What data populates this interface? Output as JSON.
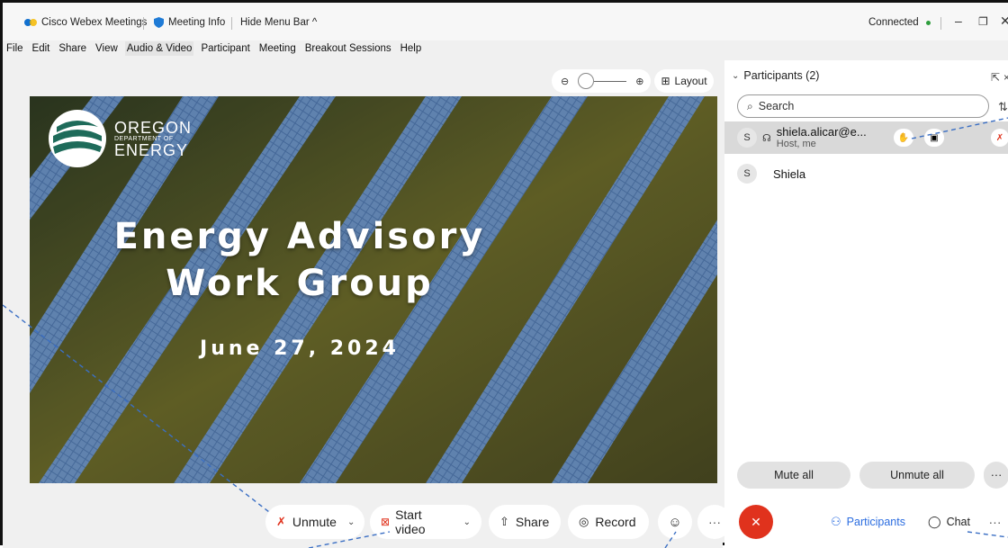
{
  "titlebar": {
    "app_name": "Cisco Webex Meetings",
    "meeting_info": "Meeting Info",
    "hide_menu": "Hide Menu Bar ^",
    "status": "Connected",
    "status_color": "#2e9d3c"
  },
  "menu": [
    "File",
    "Edit",
    "Share",
    "View",
    "Audio & Video",
    "Participant",
    "Meeting",
    "Breakout Sessions",
    "Help"
  ],
  "stage": {
    "layout_label": "Layout",
    "slide": {
      "logo_line1": "OREGON",
      "logo_line2": "DEPARTMENT OF",
      "logo_line3": "ENERGY",
      "title_line1": "Energy Advisory",
      "title_line2": "Work Group",
      "date": "June 27, 2024"
    }
  },
  "controls": {
    "unmute": "Unmute",
    "start_video": "Start video",
    "share": "Share",
    "record": "Record",
    "more": "···",
    "participants": "Participants",
    "chat": "Chat",
    "end_color": "#e0321d",
    "accent": "#2b6de0"
  },
  "panel": {
    "title": "Participants (2)",
    "search_placeholder": "Search",
    "participants": [
      {
        "initial": "S",
        "name": "shiela.alicar@e...",
        "role": "Host, me"
      },
      {
        "initial": "S",
        "name": "Shiela",
        "role": ""
      }
    ],
    "mute_all": "Mute all",
    "unmute_all": "Unmute all",
    "more": "···"
  }
}
